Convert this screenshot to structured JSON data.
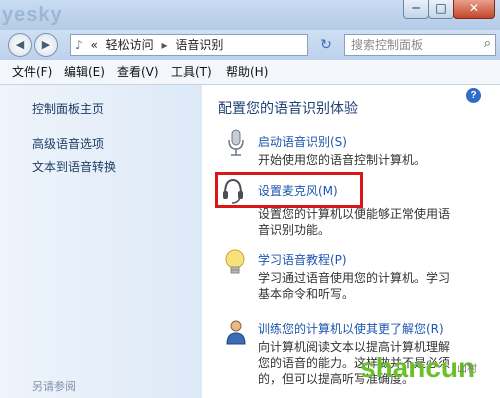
{
  "window": {
    "watermark": "yesky",
    "controls": {
      "minimize": "─",
      "maximize": "□",
      "close": "✕"
    }
  },
  "address": {
    "back_icon": "back-arrow-icon",
    "path_prefix": "«",
    "crumbs": [
      "轻松访问",
      "语音识别"
    ],
    "crumb_separator": "▸",
    "refresh_icon": "refresh-icon",
    "search_placeholder": "搜索控制面板"
  },
  "menu": [
    "文件(F)",
    "编辑(E)",
    "查看(V)",
    "工具(T)",
    "帮助(H)"
  ],
  "sidebar": {
    "links": [
      "控制面板主页",
      "高级语音选项",
      "文本到语音转换"
    ],
    "footer": "另请参阅"
  },
  "main": {
    "heading": "配置您的语音识别体验",
    "tasks": [
      {
        "icon": "microphone-icon",
        "link": "启动语音识别(S)",
        "desc": "开始使用您的语音控制计算机。"
      },
      {
        "icon": "headset-icon",
        "link": "设置麦克风(M)",
        "desc": "设置您的计算机以便能够正常使用语音识别功能。"
      },
      {
        "icon": "lightbulb-icon",
        "link": "学习语音教程(P)",
        "desc": "学习通过语音使用您的计算机。学习基本命令和听写。"
      },
      {
        "icon": "user-training-icon",
        "link": "训练您的计算机以使其更了解您(R)",
        "desc": "向计算机阅读文本以提高计算机理解您的语音的能力。这样做并不是必须的，但可以提高听写准确度。"
      }
    ]
  },
  "brand": {
    "name": "shancun",
    "sub": "山村"
  },
  "colors": {
    "link": "#1c56b0",
    "highlight_box": "#d9171b",
    "brand": "#6ac02a"
  }
}
